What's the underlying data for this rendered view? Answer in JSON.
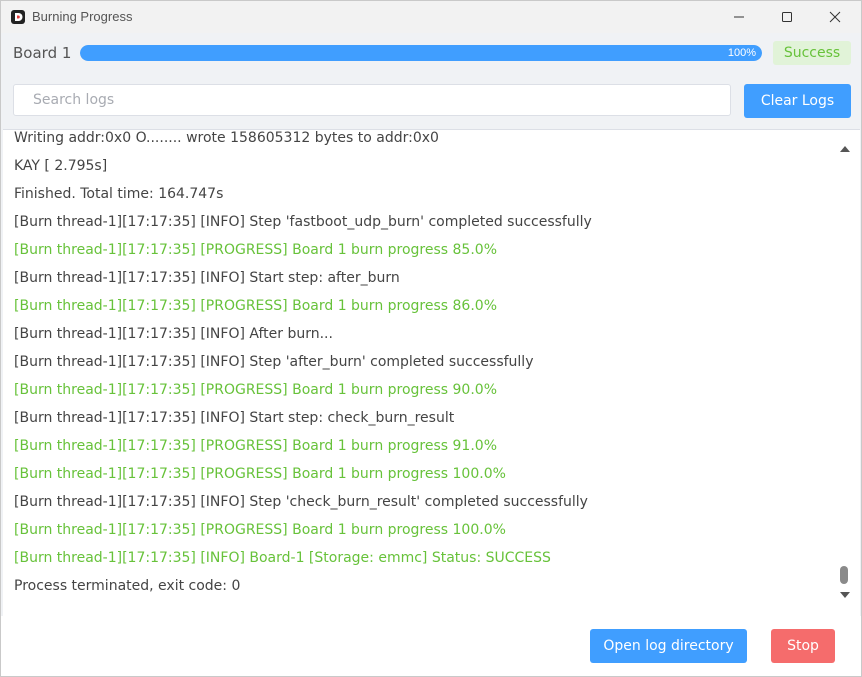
{
  "window": {
    "title": "Burning Progress"
  },
  "board": {
    "label": "Board 1",
    "progress_percent": 100,
    "progress_text": "100%",
    "status": "Success"
  },
  "search": {
    "placeholder": "Search logs",
    "value": ""
  },
  "toolbar": {
    "clear_label": "Clear Logs"
  },
  "logs": [
    {
      "text": "Writing  addr:0x0 O........ wrote 158605312 bytes to  addr:0x0",
      "type": "info"
    },
    {
      "text": "KAY [ 2.795s]",
      "type": "info"
    },
    {
      "text": "Finished. Total time: 164.747s",
      "type": "info"
    },
    {
      "text": "[Burn thread-1][17:17:35] [INFO] Step 'fastboot_udp_burn' completed successfully",
      "type": "info"
    },
    {
      "text": "[Burn thread-1][17:17:35] [PROGRESS] Board 1 burn progress 85.0%",
      "type": "progress"
    },
    {
      "text": "[Burn thread-1][17:17:35] [INFO] Start step: after_burn",
      "type": "info"
    },
    {
      "text": "[Burn thread-1][17:17:35] [PROGRESS] Board 1 burn progress 86.0%",
      "type": "progress"
    },
    {
      "text": "[Burn thread-1][17:17:35] [INFO] After burn...",
      "type": "info"
    },
    {
      "text": "[Burn thread-1][17:17:35] [INFO] Step 'after_burn' completed successfully",
      "type": "info"
    },
    {
      "text": "[Burn thread-1][17:17:35] [PROGRESS] Board 1 burn progress 90.0%",
      "type": "progress"
    },
    {
      "text": "[Burn thread-1][17:17:35] [INFO] Start step: check_burn_result",
      "type": "info"
    },
    {
      "text": "[Burn thread-1][17:17:35] [PROGRESS] Board 1 burn progress 91.0%",
      "type": "progress"
    },
    {
      "text": "[Burn thread-1][17:17:35] [PROGRESS] Board 1 burn progress 100.0%",
      "type": "progress"
    },
    {
      "text": "[Burn thread-1][17:17:35] [INFO] Step 'check_burn_result' completed successfully",
      "type": "info"
    },
    {
      "text": "[Burn thread-1][17:17:35] [PROGRESS] Board 1 burn progress 100.0%",
      "type": "progress"
    },
    {
      "text": "[Burn thread-1][17:17:35] [INFO] Board-1 [Storage: emmc] Status: SUCCESS",
      "type": "progress"
    },
    {
      "text": "Process terminated, exit code: 0",
      "type": "info"
    }
  ],
  "footer": {
    "open_log_label": "Open log directory",
    "stop_label": "Stop"
  },
  "icons": {
    "app": "app-logo-icon",
    "minimize": "minimize-icon",
    "maximize": "maximize-icon",
    "close": "close-icon",
    "scroll_up": "chevron-up-icon",
    "scroll_down": "chevron-down-icon"
  },
  "colors": {
    "primary": "#409eff",
    "success": "#67c23a",
    "success_bg": "#e1f3d8",
    "danger": "#f56c6c"
  }
}
